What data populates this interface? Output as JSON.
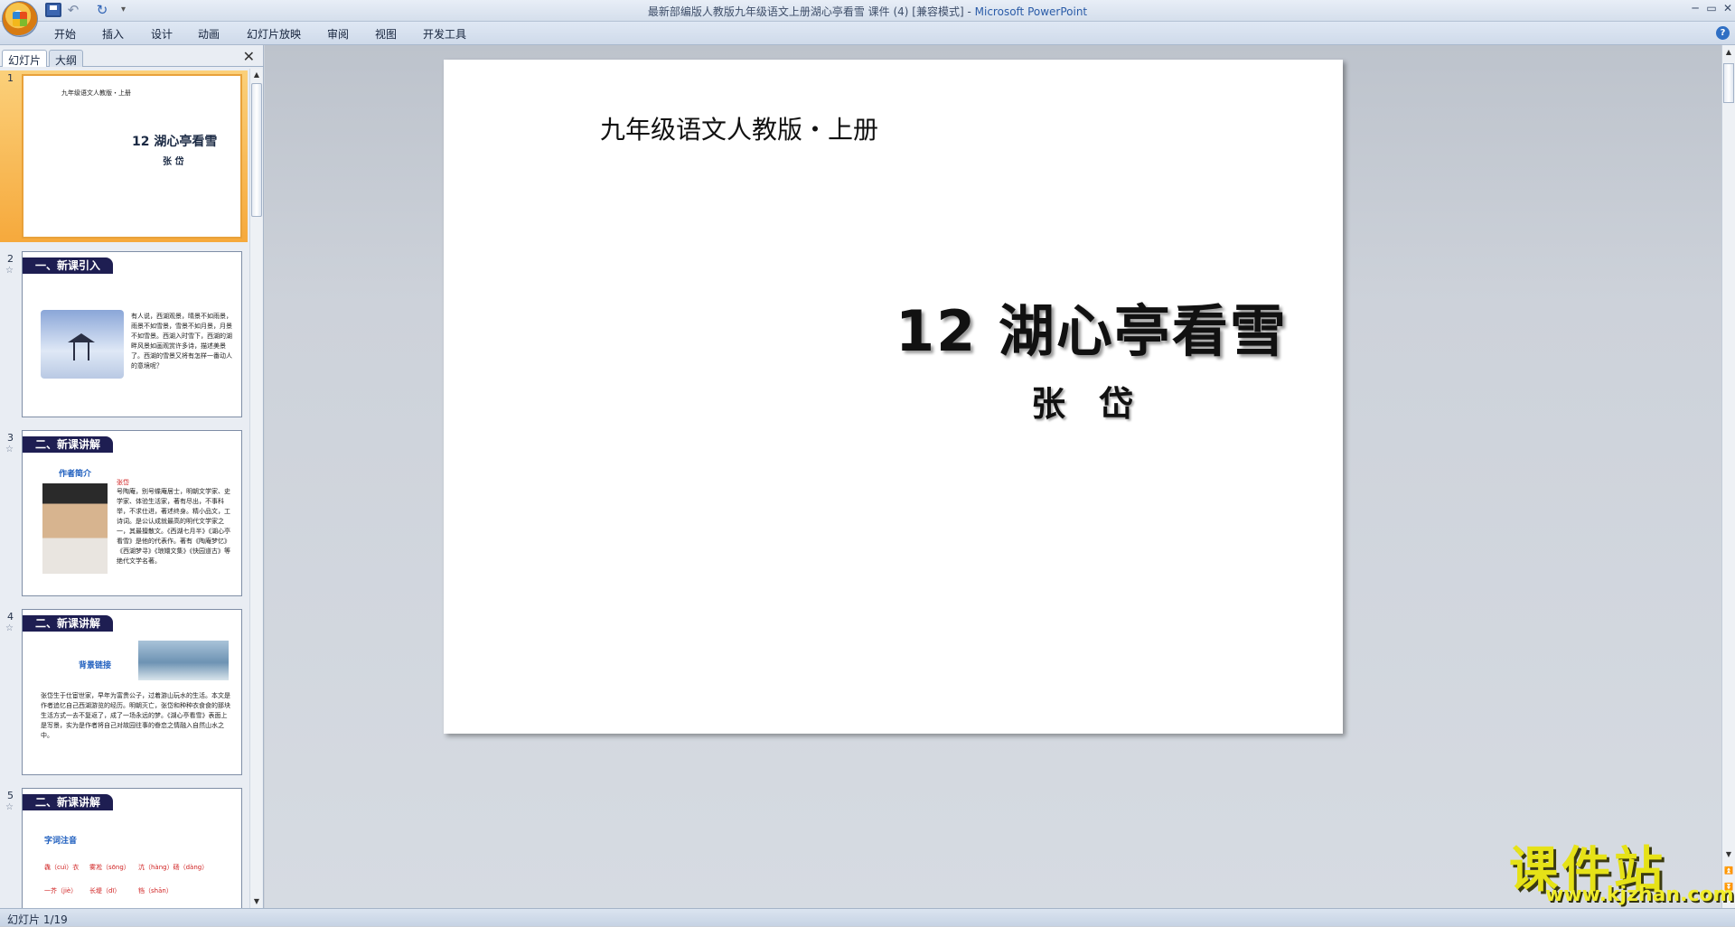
{
  "window": {
    "title": "最新部编版人教版九年级语文上册湖心亭看雪 课件 (4) [兼容模式] - ",
    "app_name": "Microsoft PowerPoint",
    "min": "─",
    "max": "▭",
    "close": "✕"
  },
  "ribbon": {
    "tabs": [
      "开始",
      "插入",
      "设计",
      "动画",
      "幻灯片放映",
      "审阅",
      "视图",
      "开发工具"
    ],
    "help": "?"
  },
  "panel": {
    "tabs": [
      "幻灯片",
      "大纲"
    ],
    "close": "✕",
    "thumbnails": [
      {
        "num": "1",
        "line1": "九年级语文人教版・上册",
        "title": "12 湖心亭看雪",
        "author": "张 岱"
      },
      {
        "num": "2",
        "header": "一、新课引入",
        "text": "有人说，西湖观景，晴景不如雨景，雨景不如雪景，雪景不如月景，月景不如雪景。西湖入时雪下，西湖的湖畔风景如画观赏许多诗，描述美景了。西湖的雪景又将有怎样一番动人的意境呢？"
      },
      {
        "num": "3",
        "header": "二、新课讲解",
        "label": "作者简介",
        "name": "张岱",
        "text": "号陶庵，别号蝶庵居士，明朝文学家、史学家、体验生活家，著有尽出，不事科举，不求仕进，著述终身。精小品文，工诗词。是公认成就最高的明代文学家之一，其最擅散文。《西湖七月半》《湖心亭看雪》是他的代表作。著有《陶庵梦忆》《西湖梦寻》《琅嬛文集》《快园道古》等绝代文学名著。"
      },
      {
        "num": "4",
        "header": "二、新课讲解",
        "label": "背景链接",
        "text": "张岱生于仕宦世家，早年为富贵公子，过着游山玩水的生活。本文是作者追忆自己西湖游览的经历。明朝灭亡，张岱和种种衣食食的那块生活方式一去不复返了，成了一场永远的梦。《湖心亭看雪》表面上是写景，实为是作者将自己对故园往事的眷恋之情融入自然山水之中。"
      },
      {
        "num": "5",
        "header": "二、新课讲解",
        "label": "字词注音",
        "row1": [
          "毳（cuì）衣",
          "雾凇（sōng）",
          "沆（hàng）砀（dàng）"
        ],
        "row2": [
          "一芥（jiè）",
          "长堤（dī）",
          "铛（shān）"
        ]
      }
    ]
  },
  "slide": {
    "subtitle": "九年级语文人教版・上册",
    "title": "12  湖心亭看雪",
    "author": "张 岱"
  },
  "status": {
    "slide_info": "幻灯片 1/19"
  },
  "watermark": {
    "cn": "课件站",
    "url": "www.kjzhan.com"
  }
}
